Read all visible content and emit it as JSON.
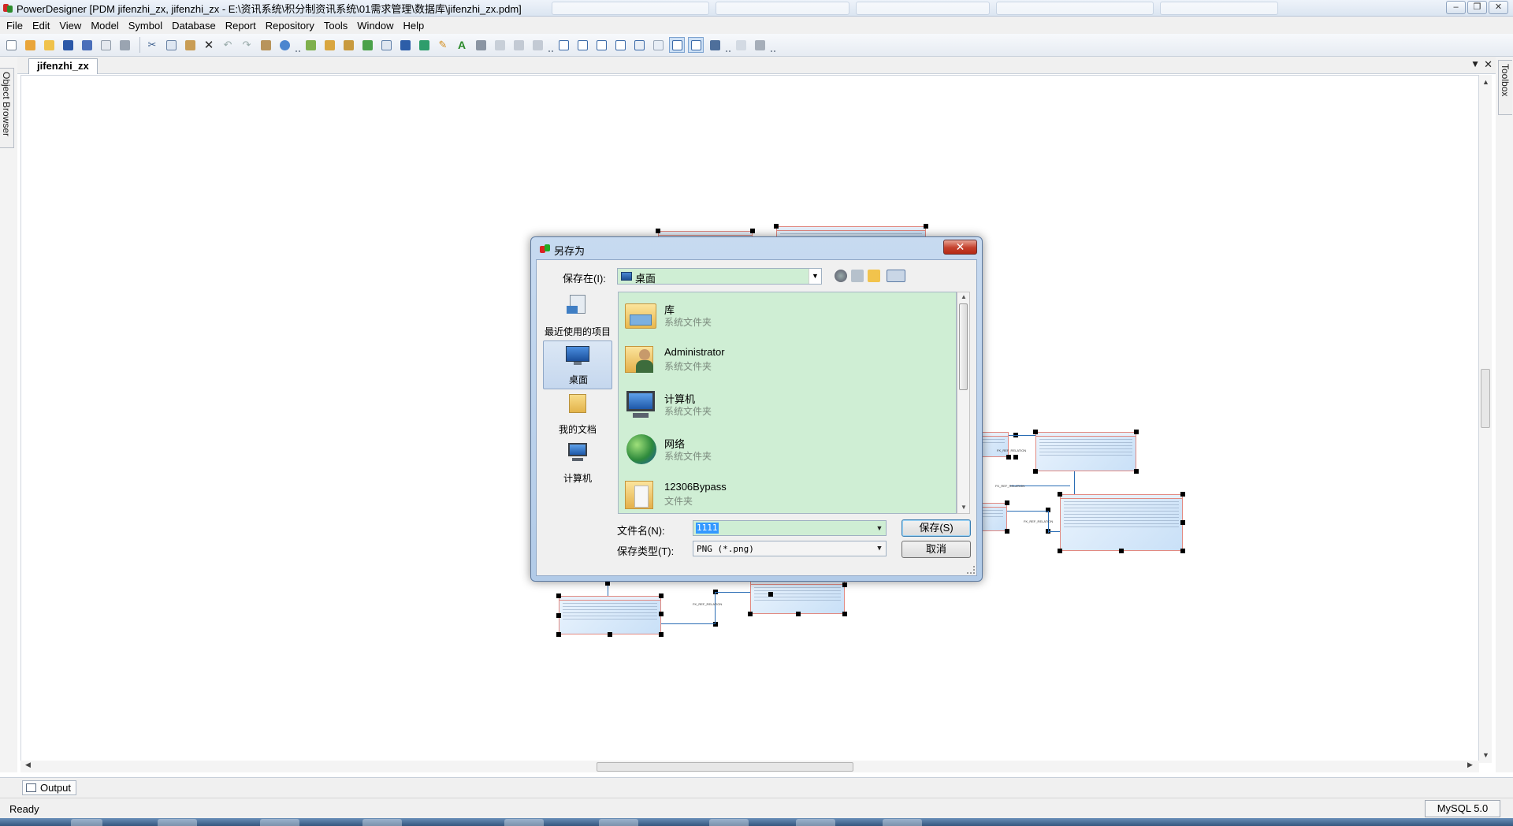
{
  "window": {
    "title": "PowerDesigner [PDM jifenzhi_zx, jifenzhi_zx - E:\\资讯系统\\积分制资讯系统\\01需求管理\\数据库\\jifenzhi_zx.pdm]"
  },
  "menu": {
    "items": [
      "File",
      "Edit",
      "View",
      "Model",
      "Symbol",
      "Database",
      "Report",
      "Repository",
      "Tools",
      "Window",
      "Help"
    ]
  },
  "side_panels": {
    "object_browser": "Object Browser",
    "toolbox": "Toolbox"
  },
  "document": {
    "tab_label": "jifenzhi_zx"
  },
  "output": {
    "tab_label": "Output"
  },
  "status": {
    "text": "Ready",
    "dbms": "MySQL 5.0"
  },
  "dialog": {
    "title": "另存为",
    "save_in_label": "保存在(I):",
    "save_in_value": "桌面",
    "places": [
      {
        "label": "最近使用的项目",
        "icon": "recent-items-icon"
      },
      {
        "label": "桌面",
        "icon": "desktop-icon"
      },
      {
        "label": "我的文档",
        "icon": "documents-icon"
      },
      {
        "label": "计算机",
        "icon": "computer-icon"
      }
    ],
    "files": [
      {
        "name": "库",
        "type": "系统文件夹",
        "icon": "library-folder-icon"
      },
      {
        "name": "Administrator",
        "type": "系统文件夹",
        "icon": "user-folder-icon"
      },
      {
        "name": "计算机",
        "type": "系统文件夹",
        "icon": "computer-icon"
      },
      {
        "name": "网络",
        "type": "系统文件夹",
        "icon": "network-globe-icon"
      },
      {
        "name": "12306Bypass",
        "type": "文件夹",
        "icon": "folder-icon"
      }
    ],
    "filename_label": "文件名(N):",
    "filename_value": "1111",
    "filetype_label": "保存类型(T):",
    "filetype_value": "PNG (*.png)",
    "save_button": "保存(S)",
    "cancel_button": "取消"
  },
  "colors": {
    "list_background": "#cfeed4",
    "entity_fill": "#c9e0f7",
    "entity_border": "#e28a82",
    "reference_line": "#2a6db5"
  }
}
